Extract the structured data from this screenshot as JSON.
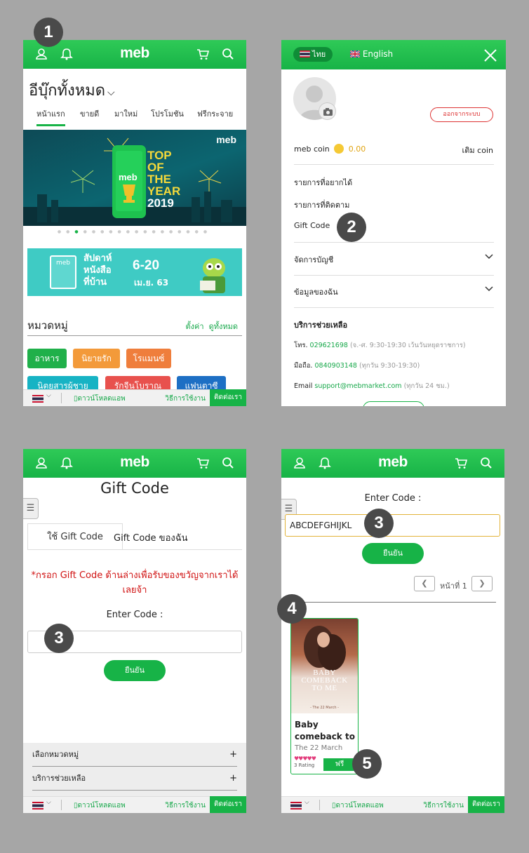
{
  "app": {
    "logo": "meb"
  },
  "markers": [
    "1",
    "2",
    "3",
    "3",
    "4",
    "5"
  ],
  "panel1": {
    "title": "อีบุ๊กทั้งหมด",
    "title_chevron": "⌵",
    "tabs": [
      "หน้าแรก",
      "ขายดี",
      "มาใหม่",
      "โปรโมชัน",
      "ฟรีกระจาย"
    ],
    "active_tab": "หน้าแรก",
    "banner": {
      "brand": "meb",
      "app_label": "meb",
      "headline": [
        "TOP",
        "OF",
        "THE",
        "YEAR"
      ],
      "year": "2019"
    },
    "banner2": {
      "book_label": "meb",
      "line1": "สัปดาห์",
      "line2": "หนังสือ",
      "line3": "ที่บ้าน",
      "dates": "6-20",
      "month": "เม.ย. 63"
    },
    "category": {
      "title": "หมวดหมู่",
      "settings_link": "ตั้งค่า",
      "all_link": "ดูทั้งหมด"
    },
    "chips": [
      {
        "label": "อาหาร",
        "color": "#20b04a"
      },
      {
        "label": "นิยายรัก",
        "color": "#f39a3a"
      },
      {
        "label": "โรแมนซ์",
        "color": "#ef7e3c"
      },
      {
        "label": "นิตยสารผู้ชาย",
        "color": "#17b3c4"
      },
      {
        "label": "รักจีนโบราณ",
        "color": "#e8514d"
      },
      {
        "label": "แฟนตาซี",
        "color": "#1d6fc4"
      }
    ]
  },
  "footer": {
    "flag_chevron": "⌵",
    "download": "ดาวน์โหลดแอพ",
    "howto": "วิธีการใช้งาน",
    "contact": "ติดต่อเรา"
  },
  "panel2": {
    "lang_thai": "ไทย",
    "lang_english": "English",
    "logout": "ออกจากระบบ",
    "coin_label": "meb coin",
    "coin_value": "0.00",
    "topup": "เติม coin",
    "menu": [
      "รายการที่อยากได้",
      "รายการที่ติดตาม",
      "Gift Code"
    ],
    "collapsibles": [
      "จัดการบัญชี",
      "ข้อมูลของฉัน"
    ],
    "support_title": "บริการช่วยเหลือ",
    "phone_label": "โทร.",
    "phone": "029621698",
    "phone_hours": "(จ.-ศ. 9:30-19:30 เว้นวันหยุดราชการ)",
    "mobile_label": "มือถือ.",
    "mobile": "0840903148",
    "mobile_hours": "(ทุกวัน 9:30-19:30)",
    "email_label": "Email",
    "email": "support@mebmarket.com",
    "email_hours": "(ทุกวัน 24 ชม.)"
  },
  "panel3": {
    "title": "Gift Code",
    "tab_use": "ใช้ Gift Code",
    "tab_mine": "Gift Code ของฉัน",
    "message": "*กรอก Gift Code ด้านล่างเพื่อรับของขวัญจากเราได้เลยจ้า",
    "enter_label": "Enter Code :",
    "code_value": "",
    "confirm": "ยืนยัน",
    "accordion": [
      "เลือกหมวดหมู่",
      "บริการช่วยเหลือ"
    ],
    "accordion_icon": "+"
  },
  "panel4": {
    "enter_label": "Enter Code :",
    "code_value": "ABCDEFGHIJKL",
    "confirm": "ยืนยัน",
    "page_label": "หน้าที่ 1",
    "book": {
      "cover_text": [
        "BABY",
        "COMEBACK",
        "TO ME"
      ],
      "cover_sub": "- The 22 March -",
      "title": "Baby comeback to",
      "author": "The 22 March",
      "stars": "♥♥♥♥♥",
      "rating": "3 Rating",
      "price": "ฟรี"
    }
  },
  "colors": {
    "brand_green": "#17b347",
    "link_green": "#17a84a",
    "alert_red": "#d01010",
    "marker_gray": "#4a4a4a"
  },
  "icons": [
    "user-icon",
    "bell-icon",
    "cart-icon",
    "search-icon",
    "close-icon",
    "camera-icon",
    "coin-icon",
    "phone-download-icon",
    "menu-handle-icon"
  ]
}
